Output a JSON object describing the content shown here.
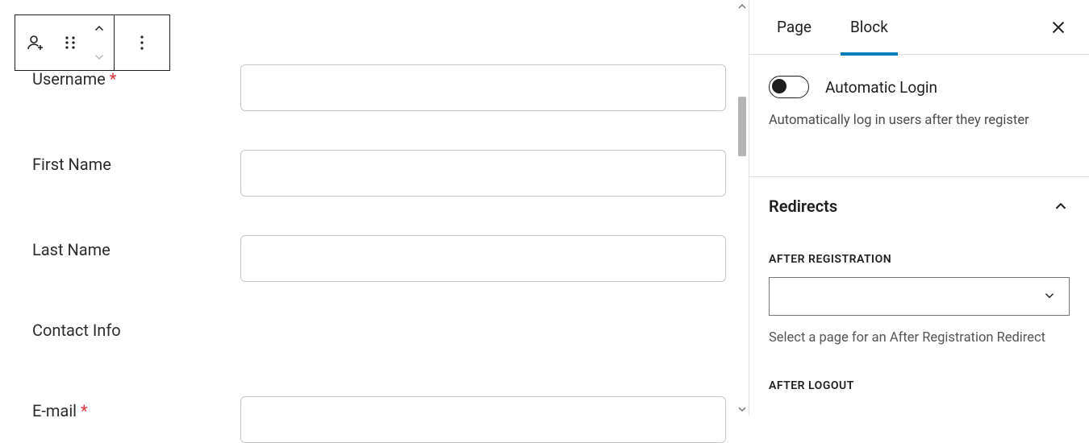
{
  "toolbar": {
    "block_icon": "user-add-icon",
    "drag_icon": "drag-icon",
    "move_up_icon": "chevron-up-icon",
    "move_down_icon": "chevron-down-icon",
    "options_icon": "options-icon"
  },
  "form": {
    "fields": [
      {
        "label": "Username",
        "required": true,
        "value": ""
      },
      {
        "label": "First Name",
        "required": false,
        "value": ""
      },
      {
        "label": "Last Name",
        "required": false,
        "value": ""
      }
    ],
    "section_title": "Contact Info",
    "email": {
      "label": "E-mail",
      "required": true,
      "value": ""
    }
  },
  "sidebar": {
    "tabs": {
      "page": "Page",
      "block": "Block",
      "active": "block"
    },
    "autologin": {
      "label": "Automatic Login",
      "enabled": false,
      "description": "Automatically log in users after they register"
    },
    "redirects": {
      "title": "Redirects",
      "after_registration": {
        "heading": "AFTER REGISTRATION",
        "selected": "",
        "options": [],
        "help": "Select a page for an After Registration Redirect"
      },
      "after_logout": {
        "heading": "AFTER LOGOUT"
      }
    }
  }
}
